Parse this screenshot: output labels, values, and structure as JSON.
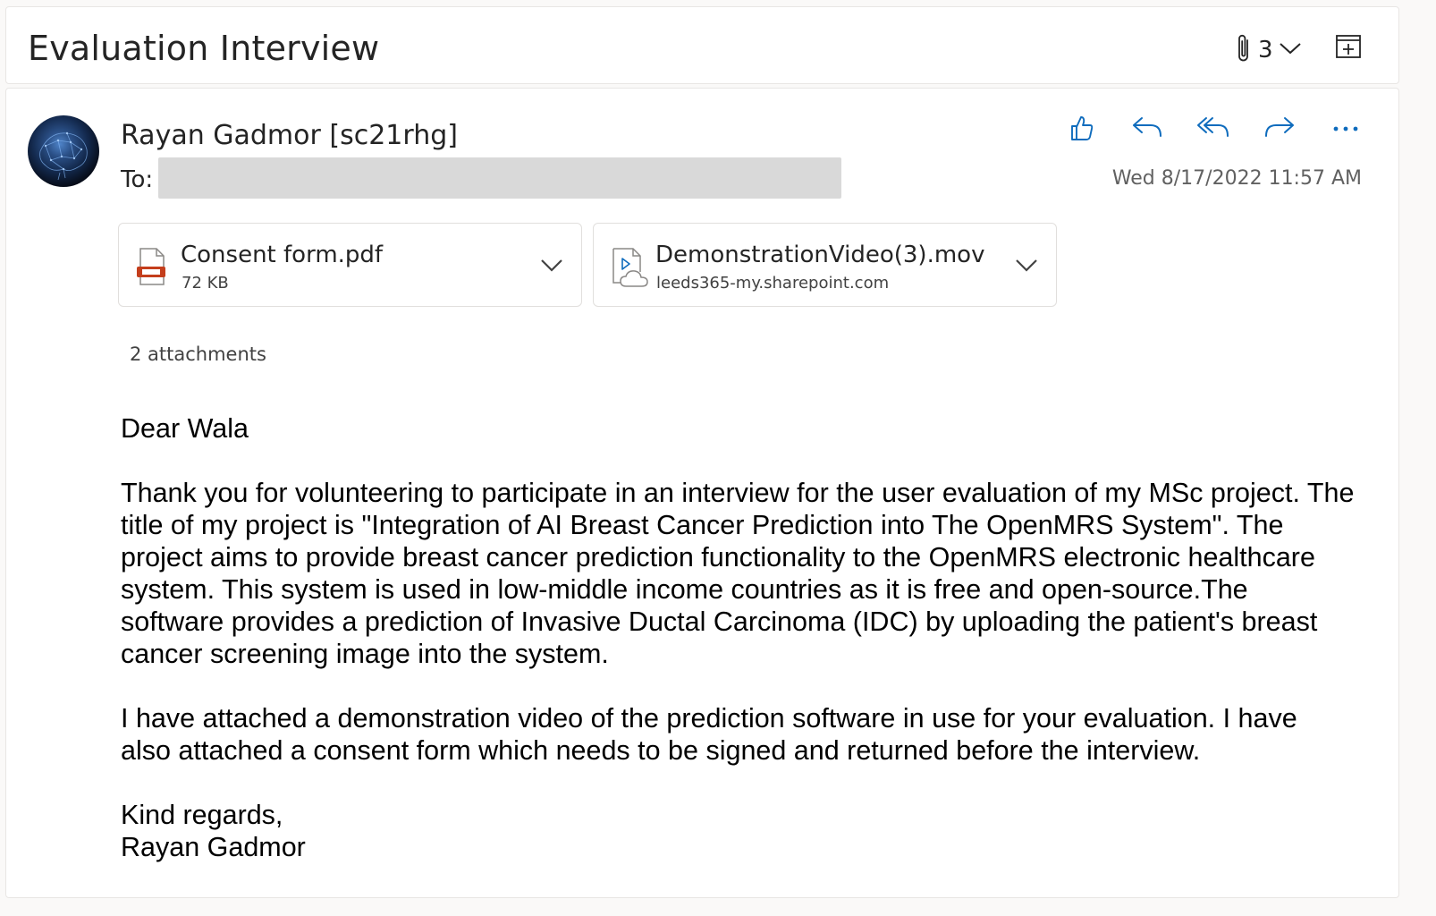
{
  "header": {
    "subject": "Evaluation Interview",
    "attachment_count": "3"
  },
  "message": {
    "sender": "Rayan Gadmor [sc21rhg]",
    "to_label": "To:",
    "date": "Wed 8/17/2022 11:57 AM",
    "attachments": [
      {
        "name": "Consent form.pdf",
        "detail": "72 KB",
        "icon": "pdf-file-icon",
        "accent": "#c43e1c"
      },
      {
        "name": "DemonstrationVideo(3).mov",
        "detail": "leeds365-my.sharepoint.com",
        "icon": "cloud-video-file-icon",
        "accent": "#0f6cbd"
      }
    ],
    "attachments_summary": "2 attachments",
    "body": {
      "greeting": "Dear Wala",
      "paragraph1": "Thank you for volunteering to participate in an interview for the user evaluation of my MSc project. The title of my project is \"Integration of AI Breast Cancer Prediction into The OpenMRS System\". The project aims to provide breast cancer prediction functionality to the OpenMRS electronic healthcare system. This system is used in low-middle income countries as it is free and open-source.The software provides a prediction of Invasive Ductal Carcinoma (IDC) by uploading the patient's breast cancer screening image into the system.",
      "paragraph2": "I have attached a demonstration video of the prediction software in use for your evaluation. I have also attached a consent form which needs to be signed and returned before the interview.",
      "closing": "Kind regards,",
      "signature": "Rayan Gadmor"
    }
  },
  "theme": {
    "accent": "#0f6cbd",
    "redaction": "#d9d9d9"
  }
}
